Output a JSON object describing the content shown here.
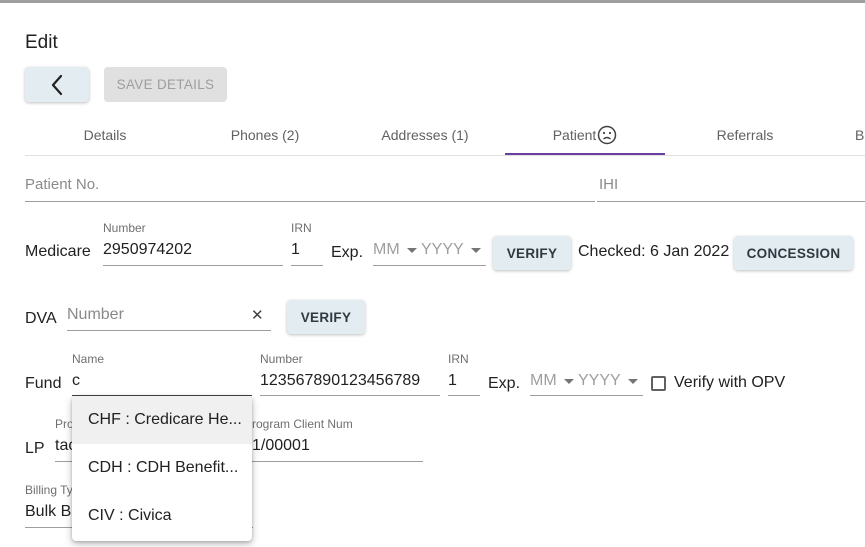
{
  "page": {
    "title": "Edit",
    "save_label": "SAVE DETAILS"
  },
  "tabs": [
    {
      "label": "Details"
    },
    {
      "label": "Phones (2)"
    },
    {
      "label": "Addresses (1)"
    },
    {
      "label": "Patient"
    },
    {
      "label": "Referrals"
    },
    {
      "label": "B"
    }
  ],
  "patient": {
    "patient_no_placeholder": "Patient No.",
    "ihi_placeholder": "IHI"
  },
  "medicare": {
    "label": "Medicare",
    "number_label": "Number",
    "number_value": "2950974202",
    "irn_label": "IRN",
    "irn_value": "1",
    "exp_label": "Exp.",
    "month_placeholder": "MM",
    "year_placeholder": "YYYY",
    "verify_label": "VERIFY",
    "checked_text": "Checked: 6 Jan 2022",
    "concession_label": "CONCESSION"
  },
  "dva": {
    "label": "DVA",
    "number_placeholder": "Number",
    "clear_glyph": "✕",
    "verify_label": "VERIFY"
  },
  "fund": {
    "label": "Fund",
    "name_label": "Name",
    "name_value": "c",
    "number_label": "Number",
    "number_value": "123567890123456789",
    "irn_label": "IRN",
    "irn_value": "1",
    "exp_label": "Exp.",
    "month_placeholder": "MM",
    "year_placeholder": "YYYY",
    "verify_opv_label": "Verify with OPV"
  },
  "lp": {
    "label": "LP",
    "program_label_visible": "Pro",
    "program_value_visible": "tac",
    "client_num_label_visible": "rogram Client Num",
    "client_num_value_visible": "1/00001"
  },
  "billing": {
    "type_label_visible": "Billing Ty",
    "type_value_visible": "Bulk Bi"
  },
  "dropdown": {
    "items": [
      {
        "label": "CHF : Credicare He..."
      },
      {
        "label": "CDH : CDH Benefit..."
      },
      {
        "label": "CIV : Civica"
      }
    ]
  }
}
